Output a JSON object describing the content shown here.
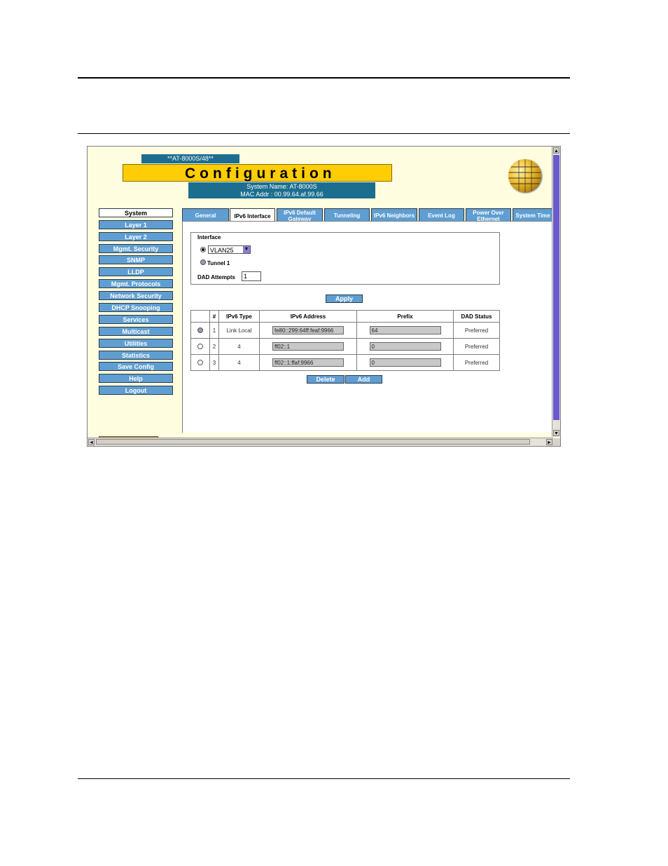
{
  "banner": {
    "model": "**AT-8000S/48**",
    "title": "Configuration",
    "system_name": "System Name: AT-8000S",
    "mac_addr": "MAC Addr : 00.99.64.af.99.66"
  },
  "nav": {
    "items": [
      {
        "label": "System",
        "active": true
      },
      {
        "label": "Layer 1"
      },
      {
        "label": "Layer 2"
      },
      {
        "label": "Mgmt. Security"
      },
      {
        "label": "SNMP"
      },
      {
        "label": "LLDP"
      },
      {
        "label": "Mgmt. Protocols"
      },
      {
        "label": "Network Security"
      },
      {
        "label": "DHCP Snooping"
      },
      {
        "label": "Services"
      },
      {
        "label": "Multicast"
      },
      {
        "label": "Utilities"
      },
      {
        "label": "Statistics"
      },
      {
        "label": "Save Config"
      },
      {
        "label": "Help"
      },
      {
        "label": "Logout"
      }
    ]
  },
  "tabs": [
    {
      "label": "General"
    },
    {
      "label": "IPv6 Interface",
      "active": true
    },
    {
      "label": "IPv6 Default Gateway"
    },
    {
      "label": "Tunneling"
    },
    {
      "label": "IPv6 Neighbors"
    },
    {
      "label": "Event Log"
    },
    {
      "label": "Power Over Ethernet"
    },
    {
      "label": "System Time"
    }
  ],
  "interface_section": {
    "heading": "Interface",
    "vlan_value": "VLAN25",
    "tunnel_label": "Tunnel 1",
    "dad_label": "DAD Attempts",
    "dad_value": "1"
  },
  "apply_label": "Apply",
  "table": {
    "headers": [
      "#",
      "IPv6 Type",
      "IPv6 Address",
      "Prefix",
      "DAD Status"
    ],
    "rows": [
      {
        "num": "1",
        "type": "Link Local",
        "address": "fe80::299:64ff:feaf:9966",
        "prefix": "64",
        "status": "Preferred"
      },
      {
        "num": "2",
        "type": "4",
        "address": "ff02::1",
        "prefix": "0",
        "status": "Preferred"
      },
      {
        "num": "3",
        "type": "4",
        "address": "ff02::1:ffaf:9966",
        "prefix": "0",
        "status": "Preferred"
      }
    ]
  },
  "actions": {
    "delete_label": "Delete",
    "add_label": "Add"
  },
  "colors": {
    "accent_blue": "#5f9ed2",
    "banner_teal": "#1c6e8f",
    "title_yellow": "#fecd05",
    "page_bg": "#fffde0"
  }
}
